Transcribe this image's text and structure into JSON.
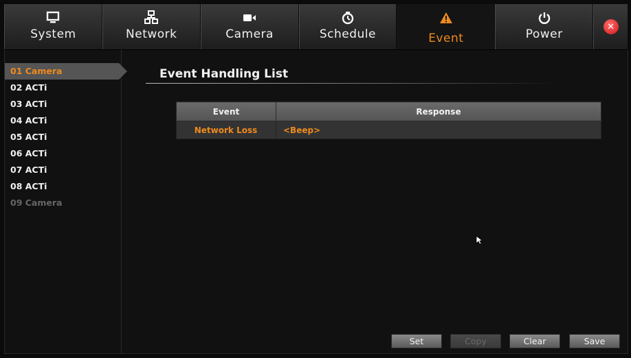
{
  "tabs": [
    {
      "label": "System",
      "icon": "monitor-icon"
    },
    {
      "label": "Network",
      "icon": "network-icon"
    },
    {
      "label": "Camera",
      "icon": "camera-icon"
    },
    {
      "label": "Schedule",
      "icon": "clock-icon"
    },
    {
      "label": "Event",
      "icon": "warning-icon",
      "active": true
    },
    {
      "label": "Power",
      "icon": "power-icon"
    }
  ],
  "close_icon": "close-icon",
  "sidebar": {
    "items": [
      {
        "label": "01 Camera",
        "state": "active"
      },
      {
        "label": "02 ACTi"
      },
      {
        "label": "03 ACTi"
      },
      {
        "label": "04 ACTi"
      },
      {
        "label": "05 ACTi"
      },
      {
        "label": "06 ACTi"
      },
      {
        "label": "07 ACTi"
      },
      {
        "label": "08 ACTi"
      },
      {
        "label": "09 Camera",
        "state": "disabled"
      }
    ]
  },
  "main": {
    "title": "Event Handling List",
    "table": {
      "headers": [
        "Event",
        "Response"
      ],
      "rows": [
        {
          "event": "Network Loss",
          "response": "<Beep>"
        }
      ]
    }
  },
  "buttons": {
    "set": "Set",
    "copy": "Copy",
    "clear": "Clear",
    "save": "Save"
  },
  "colors": {
    "accent": "#ee8a1e",
    "close": "#d01818"
  }
}
